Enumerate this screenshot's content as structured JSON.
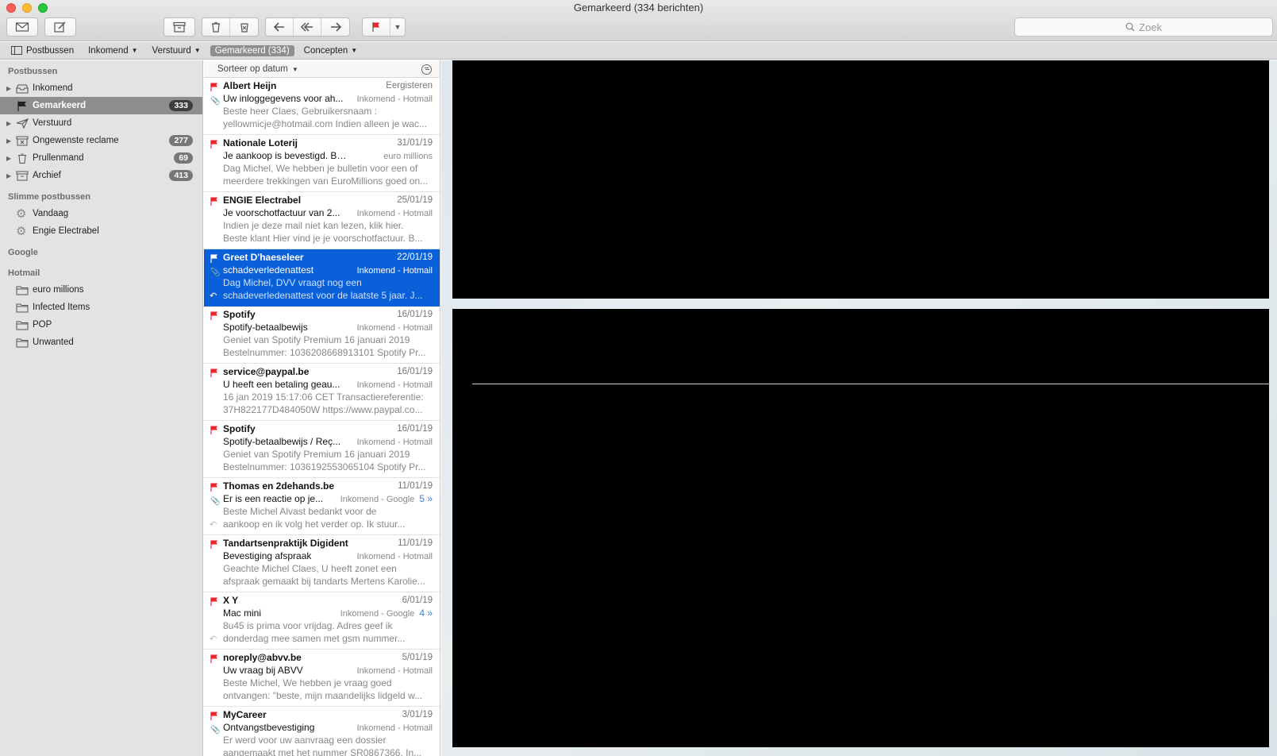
{
  "window": {
    "title": "Gemarkeerd (334 berichten)"
  },
  "toolbar": {
    "buttons": [
      "get-mail",
      "compose",
      "archive",
      "delete",
      "junk",
      "reply",
      "reply-all",
      "forward",
      "flag",
      "flag-menu"
    ],
    "search_placeholder": "Zoek"
  },
  "favorites": [
    {
      "label": "Postbussen",
      "icon": "sidebar-icon"
    },
    {
      "label": "Inkomend",
      "chevron": true
    },
    {
      "label": "Verstuurd",
      "chevron": true
    },
    {
      "label": "Gemarkeerd (334)",
      "active": true
    },
    {
      "label": "Concepten",
      "chevron": true
    }
  ],
  "sidebar": {
    "sections": {
      "postbussen": "Postbussen",
      "slimme": "Slimme postbussen",
      "google": "Google",
      "hotmail": "Hotmail"
    },
    "mailboxes": [
      {
        "label": "Inkomend",
        "icon": "inbox-icon",
        "badge": ""
      },
      {
        "label": "Gemarkeerd",
        "icon": "flag-icon",
        "badge": "333",
        "selected": true
      },
      {
        "label": "Verstuurd",
        "icon": "paper-plane-icon",
        "badge": ""
      },
      {
        "label": "Ongewenste reclame",
        "icon": "junk-icon",
        "badge": "277"
      },
      {
        "label": "Prullenmand",
        "icon": "trash-icon",
        "badge": "69"
      },
      {
        "label": "Archief",
        "icon": "archive-icon",
        "badge": "413"
      }
    ],
    "smart": [
      {
        "label": "Vandaag",
        "icon": "gear-icon"
      },
      {
        "label": "Engie Electrabel",
        "icon": "gear-icon"
      }
    ],
    "hotmail": [
      {
        "label": "euro millions",
        "icon": "folder-icon"
      },
      {
        "label": "Infected Items",
        "icon": "folder-icon"
      },
      {
        "label": "POP",
        "icon": "folder-icon"
      },
      {
        "label": "Unwanted",
        "icon": "folder-icon"
      }
    ]
  },
  "list": {
    "sort_label": "Sorteer op datum",
    "messages": [
      {
        "sender": "Albert Heijn",
        "date": "Eergisteren",
        "subject": "Uw inloggegevens voor ah...",
        "mailbox": "Inkomend - Hotmail",
        "preview1": "Beste heer Claes, Gebruikersnaam :",
        "preview2": "yellowmicje@hotmail.com Indien alleen je wac...",
        "attachment": true,
        "replied": false,
        "thread": ""
      },
      {
        "sender": "Nationale Loterij",
        "date": "31/01/19",
        "subject": "Je aankoop is bevestigd. Bedan...",
        "mailbox": "euro millions",
        "preview1": "Dag Michel, We hebben je bulletin voor een of",
        "preview2": "meerdere trekkingen van EuroMillions goed on...",
        "attachment": false,
        "replied": false,
        "thread": ""
      },
      {
        "sender": "ENGIE Electrabel",
        "date": "25/01/19",
        "subject": "Je voorschotfactuur van 2...",
        "mailbox": "Inkomend - Hotmail",
        "preview1": "Indien je deze mail niet kan lezen, klik hier.",
        "preview2": "Beste klant Hier vind je je voorschotfactuur. B...",
        "attachment": false,
        "replied": false,
        "thread": ""
      },
      {
        "sender": "Greet D'haeseleer",
        "date": "22/01/19",
        "subject": "schadeverledenattest",
        "mailbox": "Inkomend - Hotmail",
        "preview1": "Dag Michel, DVV vraagt nog een",
        "preview2": "schadeverledenattest voor de laatste 5 jaar. J...",
        "attachment": true,
        "replied": true,
        "thread": "",
        "selected": true
      },
      {
        "sender": "Spotify",
        "date": "16/01/19",
        "subject": "Spotify-betaalbewijs",
        "mailbox": "Inkomend - Hotmail",
        "preview1": "Geniet van Spotify Premium 16 januari 2019",
        "preview2": "Bestelnummer: 1036208668913101 Spotify Pr...",
        "attachment": false,
        "replied": false,
        "thread": ""
      },
      {
        "sender": "service@paypal.be",
        "date": "16/01/19",
        "subject": "U heeft een betaling geau...",
        "mailbox": "Inkomend - Hotmail",
        "preview1": "16 jan 2019 15:17:06 CET Transactiereferentie:",
        "preview2": "37H822177D484050W https://www.paypal.co...",
        "attachment": false,
        "replied": false,
        "thread": ""
      },
      {
        "sender": "Spotify",
        "date": "16/01/19",
        "subject": "Spotify-betaalbewijs / Reç...",
        "mailbox": "Inkomend - Hotmail",
        "preview1": "Geniet van Spotify Premium 16 januari 2019",
        "preview2": "Bestelnummer: 1036192553065104 Spotify Pr...",
        "attachment": false,
        "replied": false,
        "thread": ""
      },
      {
        "sender": "Thomas en 2dehands.be",
        "date": "11/01/19",
        "subject": "Er is een reactie op je...",
        "mailbox": "Inkomend - Google",
        "preview1": "Beste Michel Alvast bedankt voor de",
        "preview2": "aankoop en ik volg het verder op. Ik stuur...",
        "attachment": true,
        "replied": true,
        "thread": "5 »"
      },
      {
        "sender": "Tandartsenpraktijk Digident",
        "date": "11/01/19",
        "subject": "Bevestiging afspraak",
        "mailbox": "Inkomend - Hotmail",
        "preview1": "Geachte Michel Claes, U heeft zonet een",
        "preview2": "afspraak gemaakt bij tandarts Mertens Karolie...",
        "attachment": false,
        "replied": false,
        "thread": ""
      },
      {
        "sender": "X Y",
        "date": "6/01/19",
        "subject": "Mac mini",
        "mailbox": "Inkomend - Google",
        "preview1": "8u45 is prima voor vrijdag. Adres geef ik",
        "preview2": "donderdag mee samen met gsm nummer...",
        "attachment": false,
        "replied": true,
        "thread": "4 »"
      },
      {
        "sender": "noreply@abvv.be",
        "date": "5/01/19",
        "subject": "Uw vraag bij ABVV",
        "mailbox": "Inkomend - Hotmail",
        "preview1": "Beste Michel, We hebben je vraag goed",
        "preview2": "ontvangen: \"beste, mijn maandelijks lidgeld w...",
        "attachment": false,
        "replied": false,
        "thread": ""
      },
      {
        "sender": "MyCareer",
        "date": "3/01/19",
        "subject": "Ontvangstbevestiging",
        "mailbox": "Inkomend - Hotmail",
        "preview1": "Er werd voor uw aanvraag een dossier",
        "preview2": "aangemaakt met het nummer SR0867366. In...",
        "attachment": true,
        "replied": false,
        "thread": ""
      }
    ]
  },
  "colors": {
    "flag": "#e8242c",
    "selection": "#0a60d8",
    "accent": "#2f80ed"
  }
}
